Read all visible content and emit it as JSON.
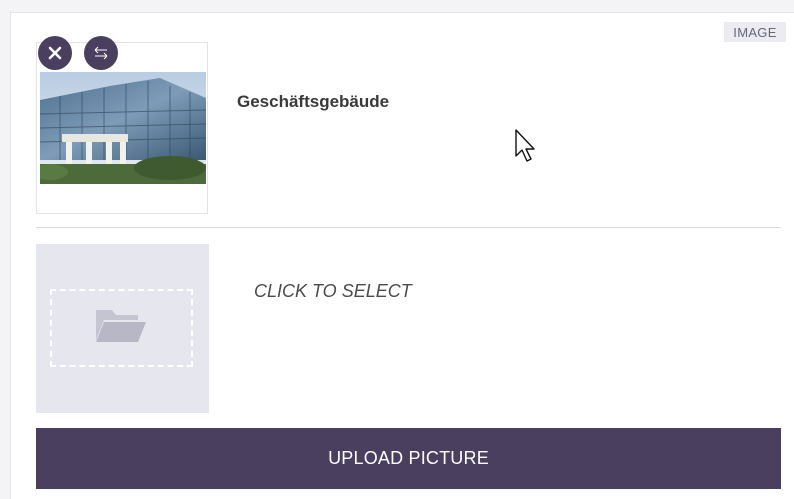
{
  "type_badge": "IMAGE",
  "item": {
    "title": "Geschäftsgebäude",
    "thumbnail_icon": "building-photo"
  },
  "controls": {
    "close_icon": "close-icon",
    "swap_icon": "swap-arrows-icon"
  },
  "select": {
    "label": "CLICK TO SELECT",
    "icon": "folder-icon"
  },
  "upload": {
    "label": "UPLOAD PICTURE"
  },
  "colors": {
    "accent": "#4a3f5e",
    "drop_zone": "#e6e6ee",
    "badge_bg": "#ebebf1"
  }
}
